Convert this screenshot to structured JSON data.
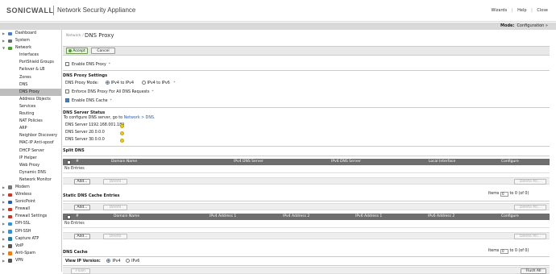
{
  "header": {
    "brand": "SONICWALL",
    "app_title": "Network Security Appliance",
    "links": [
      "Wizards",
      "Help",
      "Close"
    ],
    "separator": "|"
  },
  "modebar": {
    "label": "Mode:",
    "value": "Configuration »"
  },
  "sidebar": {
    "items": [
      {
        "label": "Dashboard",
        "level": 0,
        "icon_color": "#4a7fc1"
      },
      {
        "label": "System",
        "level": 0,
        "icon_color": "#6a6a6a"
      },
      {
        "label": "Network",
        "level": 0,
        "icon_color": "#4a9c2d",
        "expanded": true
      },
      {
        "label": "Interfaces",
        "level": 1
      },
      {
        "label": "PortShield Groups",
        "level": 1
      },
      {
        "label": "Failover & LB",
        "level": 1
      },
      {
        "label": "Zones",
        "level": 1
      },
      {
        "label": "DNS",
        "level": 1
      },
      {
        "label": "DNS Proxy",
        "level": 1,
        "active": true
      },
      {
        "label": "Address Objects",
        "level": 1
      },
      {
        "label": "Services",
        "level": 1
      },
      {
        "label": "Routing",
        "level": 1
      },
      {
        "label": "NAT Policies",
        "level": 1
      },
      {
        "label": "ARP",
        "level": 1
      },
      {
        "label": "Neighbor Discovery",
        "level": 1
      },
      {
        "label": "MAC-IP Anti-spoof",
        "level": 1
      },
      {
        "label": "DHCP Server",
        "level": 1
      },
      {
        "label": "IP Helper",
        "level": 1
      },
      {
        "label": "Web Proxy",
        "level": 1
      },
      {
        "label": "Dynamic DNS",
        "level": 1
      },
      {
        "label": "Network Monitor",
        "level": 1
      },
      {
        "label": "Modem",
        "level": 0,
        "icon_color": "#777"
      },
      {
        "label": "Wireless",
        "level": 0,
        "icon_color": "#c0392b"
      },
      {
        "label": "SonicPoint",
        "level": 0,
        "icon_color": "#2a5cab"
      },
      {
        "label": "Firewall",
        "level": 0,
        "icon_color": "#c0392b"
      },
      {
        "label": "Firewall Settings",
        "level": 0,
        "icon_color": "#c0392b"
      },
      {
        "label": "DPI-SSL",
        "level": 0,
        "icon_color": "#3a8fd1"
      },
      {
        "label": "DPI-SSH",
        "level": 0,
        "icon_color": "#3a8fd1"
      },
      {
        "label": "Capture ATP",
        "level": 0,
        "icon_color": "#2a7a9a"
      },
      {
        "label": "VoIP",
        "level": 0,
        "icon_color": "#555"
      },
      {
        "label": "Anti-Spam",
        "level": 0,
        "icon_color": "#e67e22"
      },
      {
        "label": "VPN",
        "level": 0,
        "icon_color": "#555"
      }
    ]
  },
  "main": {
    "breadcrumb": "Network /",
    "title": "DNS Proxy",
    "accept_label": "Accept",
    "cancel_label": "Cancel",
    "enable_dns_proxy": {
      "label": "Enable DNS Proxy",
      "hint": "*",
      "checked": false
    },
    "settings_title": "DNS Proxy Settings",
    "mode_label": "DNS Proxy Mode:",
    "mode_options": [
      {
        "label": "IPv4 to IPv4",
        "selected": true
      },
      {
        "label": "IPv4 to IPv6",
        "selected": false
      }
    ],
    "mode_hint": "*",
    "enforce": {
      "label": "Enforce DNS Proxy For All DNS Requests",
      "hint": "*",
      "checked": false
    },
    "cache": {
      "label": "Enable DNS Cache",
      "hint": "*",
      "checked": true
    },
    "server_status_title": "DNS Server Status",
    "server_config_text": "To configure DNS server, go to",
    "server_config_link": "Network > DNS.",
    "servers": [
      {
        "label": "DNS Server 1:",
        "value": "192.168.001.189"
      },
      {
        "label": "DNS Server 2:",
        "value": "0.0.0.0"
      },
      {
        "label": "DNS Server 3:",
        "value": "0.0.0.0"
      }
    ],
    "split_dns": {
      "title": "Split DNS",
      "columns": [
        "#",
        "Domain Name",
        "IPv4 DNS Server",
        "IPv6 DNS Server",
        "Local Interface",
        "Configure"
      ],
      "empty": "No Entries",
      "add": "Add...",
      "delete": "Delete",
      "delete_all": "Delete All..."
    },
    "static_cache": {
      "title": "Static DNS Cache Entries",
      "items_label": "Items",
      "items_from": "0",
      "items_to_text": "to 0 (of 0)",
      "columns": [
        "#",
        "Domain Name",
        "IPv4 Address 1",
        "IPv4 Address 2",
        "IPv6 Address 1",
        "IPv6 Address 2",
        "Configure"
      ],
      "empty": "No Entries",
      "add": "Add...",
      "delete": "Delete",
      "delete_all": "Delete All..."
    },
    "dns_cache": {
      "title": "DNS Cache",
      "view_label": "View IP Version:",
      "options": [
        {
          "label": "IPv4",
          "selected": true
        },
        {
          "label": "IPv6",
          "selected": false
        }
      ],
      "items_label": "Items",
      "items_from": "0",
      "items_to_text": "to 0 (of 0)",
      "flush": "Flush",
      "flush_all": "Flush All"
    }
  }
}
